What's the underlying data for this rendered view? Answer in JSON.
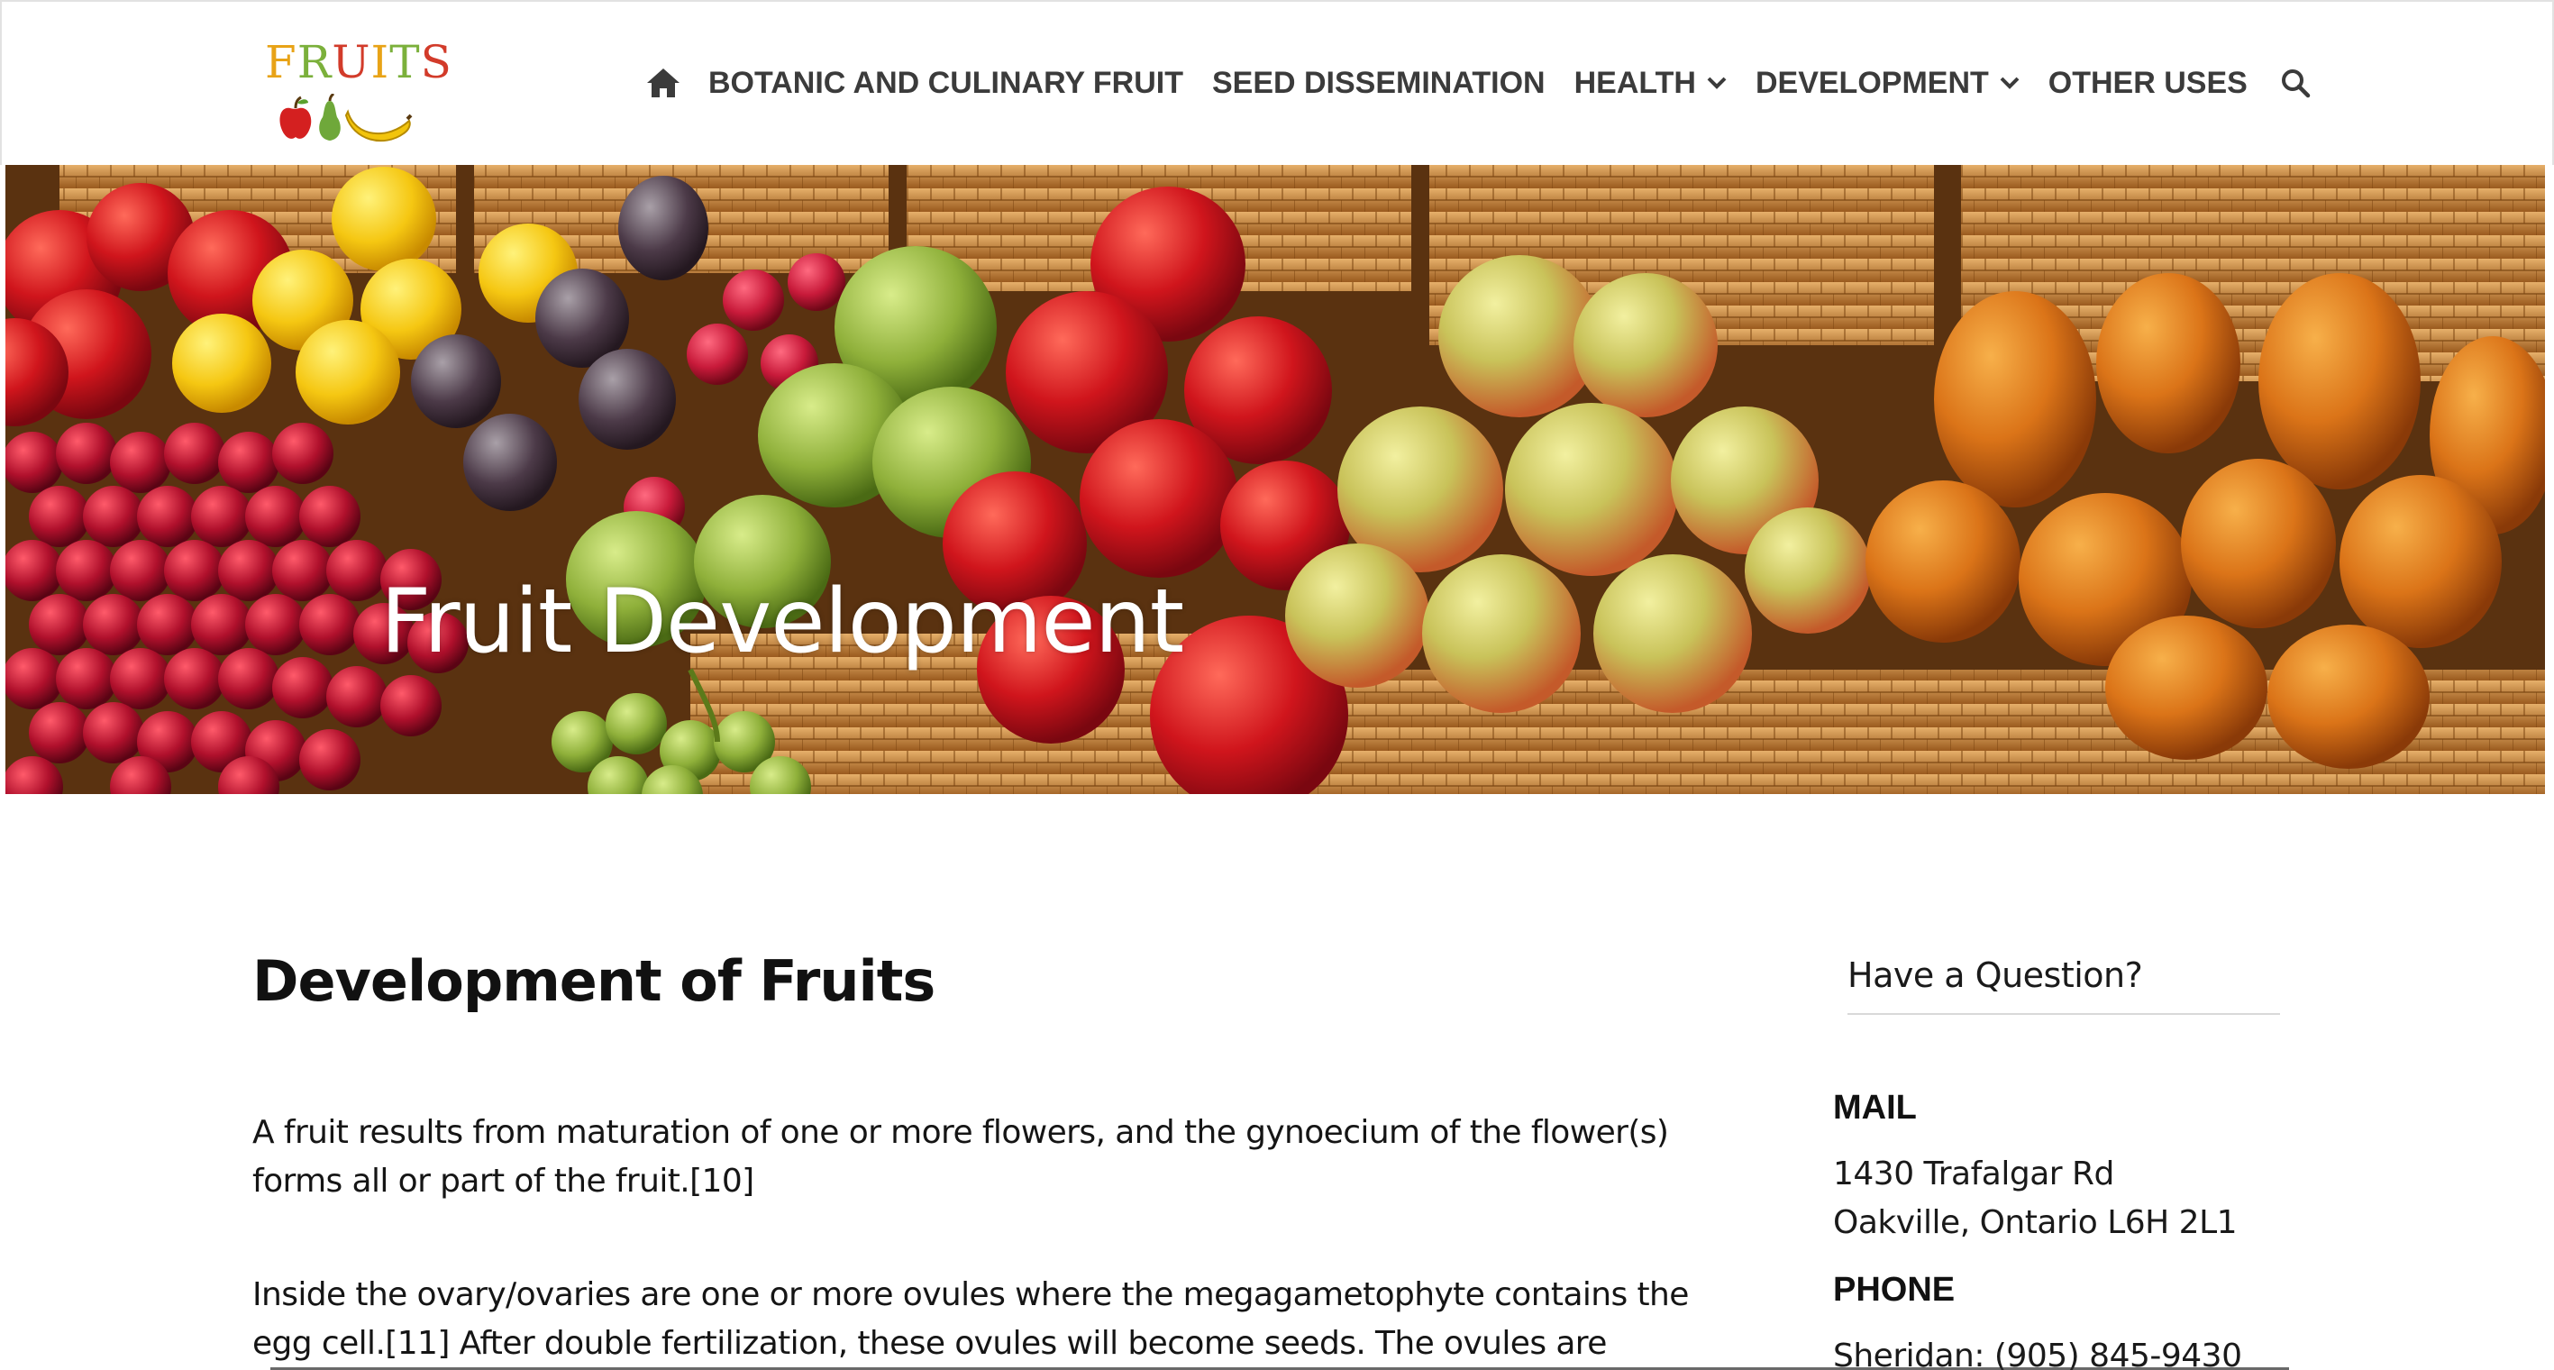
{
  "header": {
    "logo": {
      "text": "FRUITS",
      "letter_colors": [
        "#e8a317",
        "#7bb03b",
        "#d23b2a",
        "#e8a317",
        "#7bb03b",
        "#d23b2a"
      ],
      "fruit_icons": [
        "apple-icon",
        "pear-icon",
        "banana-icon"
      ]
    },
    "nav": {
      "home_icon": "home-icon",
      "items": [
        {
          "label": "BOTANIC AND CULINARY FRUIT",
          "dropdown": false
        },
        {
          "label": "SEED DISSEMINATION",
          "dropdown": false
        },
        {
          "label": "HEALTH",
          "dropdown": true
        },
        {
          "label": "DEVELOPMENT",
          "dropdown": true
        },
        {
          "label": "OTHER USES",
          "dropdown": false
        }
      ],
      "search_icon": "search-icon"
    }
  },
  "hero": {
    "title": "Fruit Development",
    "image": "fruit-market-baskets"
  },
  "main": {
    "title": "Development of Fruits",
    "paragraphs": [
      "A fruit results from maturation of one or more flowers, and the gynoecium of the flower(s) forms all or part of the fruit.[10]",
      "Inside the ovary/ovaries are one or more ovules where the megagametophyte contains the egg cell.[11] After double fertilization, these ovules will become seeds. The ovules are fertilized in a"
    ]
  },
  "sidebar": {
    "question_label": "Have a Question?",
    "mail_heading": "MAIL",
    "address_line1": "1430 Trafalgar Rd",
    "address_line2": "Oakville, Ontario L6H 2L1",
    "phone_heading": "PHONE",
    "phone_line": "Sheridan: (905) 845-9430"
  },
  "colors": {
    "nav_text": "#3b3b3b",
    "hero_title": "#ffffff"
  }
}
